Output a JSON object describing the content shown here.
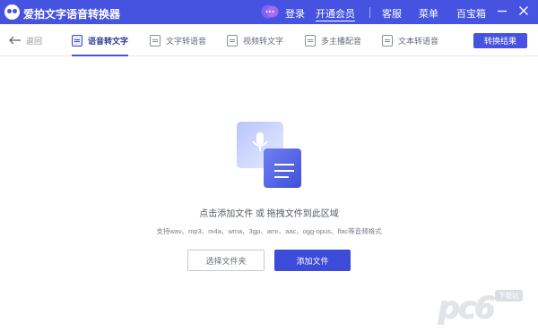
{
  "window": {
    "app_title": "爱拍文字语音转换器",
    "login_label": "登录",
    "vip_label": "开通会员",
    "service_label": "客服",
    "menu_label": "菜单",
    "toolbox_label": "百宝箱"
  },
  "toolbar": {
    "back_label": "返回",
    "tabs": [
      {
        "label": "语音转文字",
        "active": true,
        "icon": "audio-doc-icon"
      },
      {
        "label": "文字转语音",
        "active": false,
        "icon": "text-doc-icon"
      },
      {
        "label": "视频转文字",
        "active": false,
        "icon": "video-doc-icon"
      },
      {
        "label": "多主播配音",
        "active": false,
        "icon": "multi-voice-icon"
      },
      {
        "label": "文本转语音",
        "active": false,
        "icon": "text-file-icon"
      }
    ],
    "result_button_label": "转换结果"
  },
  "main": {
    "drop_text": "点击添加文件 或 拖拽文件到此区域",
    "supported_formats": "支持wav、mp3、m4a、wma、3gp、amr、aac、ogg-opus、flac等音频格式",
    "select_folder_label": "选择文件夹",
    "add_file_label": "添加文件"
  },
  "watermark": {
    "brand": "pc6",
    "tag": "下载站"
  },
  "colors": {
    "accent": "#4553e0",
    "titlebar": "#4553e0",
    "primary_button": "#3c4bd8"
  }
}
